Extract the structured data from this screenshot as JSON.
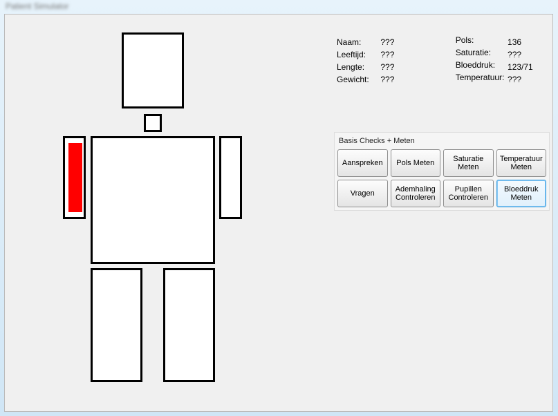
{
  "window": {
    "title": "Patient Simulator"
  },
  "patient": {
    "labels": {
      "naam": "Naam:",
      "leeftijd": "Leeftijd:",
      "lengte": "Lengte:",
      "gewicht": "Gewicht:",
      "pols": "Pols:",
      "saturatie": "Saturatie:",
      "bloeddruk": "Bloeddruk:",
      "temperatuur": "Temperatuur:"
    },
    "values": {
      "naam": "???",
      "leeftijd": "???",
      "lengte": "???",
      "gewicht": "???",
      "pols": "136",
      "saturatie": "???",
      "bloeddruk": "123/71",
      "temperatuur": "???"
    }
  },
  "figure": {
    "parts": {
      "head": {
        "status": "normal"
      },
      "neck": {
        "status": "normal"
      },
      "torso": {
        "status": "normal"
      },
      "arm_left": {
        "status": "alert",
        "color": "#ff0000"
      },
      "arm_right": {
        "status": "normal"
      },
      "leg_left": {
        "status": "normal"
      },
      "leg_right": {
        "status": "normal"
      }
    }
  },
  "checks": {
    "group_label": "Basis Checks + Meten",
    "row1": [
      {
        "label": "Aanspreken"
      },
      {
        "label": "Pols Meten"
      },
      {
        "label": "Saturatie Meten"
      },
      {
        "label": "Temperatuur Meten"
      }
    ],
    "row2": [
      {
        "label": "Vragen"
      },
      {
        "label": "Ademhaling Controleren"
      },
      {
        "label": "Pupillen Controleren"
      },
      {
        "label": "Bloeddruk Meten",
        "highlight": true
      }
    ]
  }
}
